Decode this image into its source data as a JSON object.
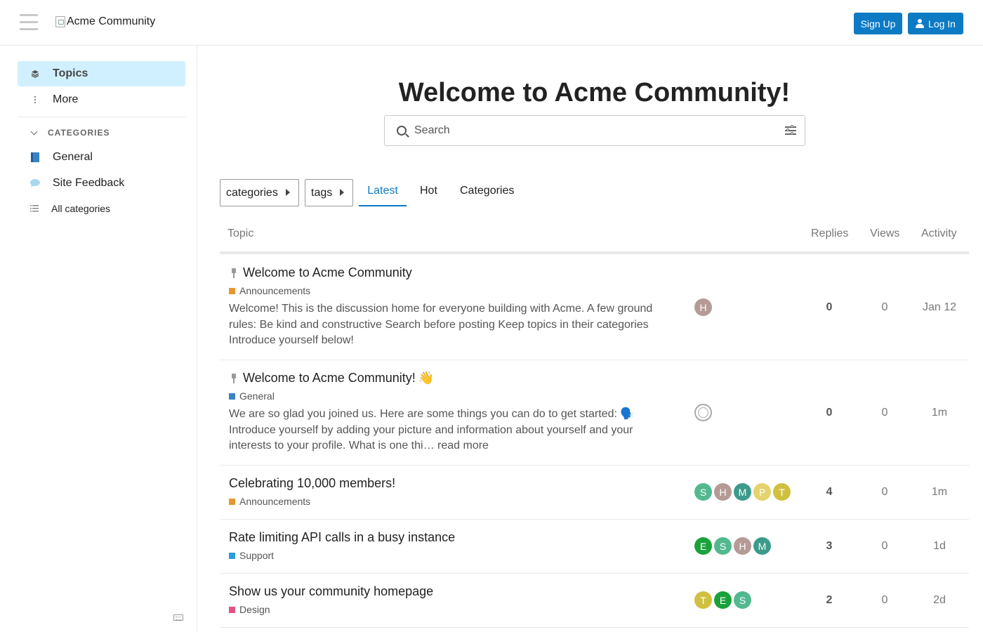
{
  "header": {
    "logo_alt": "Acme Community",
    "signup_label": "Sign Up",
    "login_label": "Log In"
  },
  "sidebar": {
    "items": [
      {
        "label": "Topics",
        "icon": "layers-icon",
        "active": true
      },
      {
        "label": "More",
        "icon": "vertical-ellipsis-icon"
      }
    ],
    "categories_header": "CATEGORIES",
    "categories": [
      {
        "label": "General",
        "icon": "book-icon",
        "color": "#3b82c4"
      },
      {
        "label": "Site Feedback",
        "icon": "speech-bubble-icon",
        "color": "#a8d8f0"
      },
      {
        "label": "All categories",
        "icon": "list-icon"
      }
    ]
  },
  "main": {
    "welcome": "Welcome to Acme Community!",
    "search_placeholder": "Search",
    "dropdowns": {
      "categories": "categories",
      "tags": "tags"
    },
    "tabs": [
      {
        "label": "Latest",
        "active": true
      },
      {
        "label": "Hot"
      },
      {
        "label": "Categories"
      }
    ],
    "columns": {
      "topic": "Topic",
      "replies": "Replies",
      "views": "Views",
      "activity": "Activity"
    }
  },
  "topics": [
    {
      "title": "Welcome to Acme Community",
      "pinned": true,
      "category": "Announcements",
      "category_color": "#e8962e",
      "excerpt": "Welcome! This is the discussion home for everyone building with Acme. A few ground rules: Be kind and constructive Search before posting Keep topics in their categories Introduce yourself below!",
      "posters": [
        {
          "letter": "H",
          "color": "#b59a96"
        }
      ],
      "replies": "0",
      "views": "0",
      "activity": "Jan 12"
    },
    {
      "title": "Welcome to Acme Community!",
      "title_emoji": "👋",
      "pinned": true,
      "category": "General",
      "category_color": "#3b82c4",
      "excerpt": "We are so glad you joined us. Here are some things you can do to get started: 🗣️ Introduce yourself by adding your picture and information about yourself and your interests to your profile. What is one thi…",
      "read_more": "read more",
      "posters": [
        {
          "letter": "",
          "color": "ring"
        }
      ],
      "replies": "0",
      "views": "0",
      "activity": "1m"
    },
    {
      "title": "Celebrating 10,000 members!",
      "category": "Announcements",
      "category_color": "#e8962e",
      "posters": [
        {
          "letter": "S",
          "color": "#52b98f"
        },
        {
          "letter": "H",
          "color": "#b59a96"
        },
        {
          "letter": "M",
          "color": "#3c9b8a"
        },
        {
          "letter": "P",
          "color": "#e4d36c"
        },
        {
          "letter": "T",
          "color": "#d1c03f"
        }
      ],
      "replies": "4",
      "views": "0",
      "activity": "1m"
    },
    {
      "title": "Rate limiting API calls in a busy instance",
      "category": "Support",
      "category_color": "#27a0dc",
      "posters": [
        {
          "letter": "E",
          "color": "#1aa23c"
        },
        {
          "letter": "S",
          "color": "#52b98f"
        },
        {
          "letter": "H",
          "color": "#b59a96"
        },
        {
          "letter": "M",
          "color": "#3c9b8a"
        }
      ],
      "replies": "3",
      "views": "0",
      "activity": "1d"
    },
    {
      "title": "Show us your community homepage",
      "category": "Design",
      "category_color": "#e45184",
      "posters": [
        {
          "letter": "T",
          "color": "#d1c03f"
        },
        {
          "letter": "E",
          "color": "#1aa23c"
        },
        {
          "letter": "S",
          "color": "#52b98f"
        }
      ],
      "replies": "2",
      "views": "0",
      "activity": "2d"
    }
  ]
}
